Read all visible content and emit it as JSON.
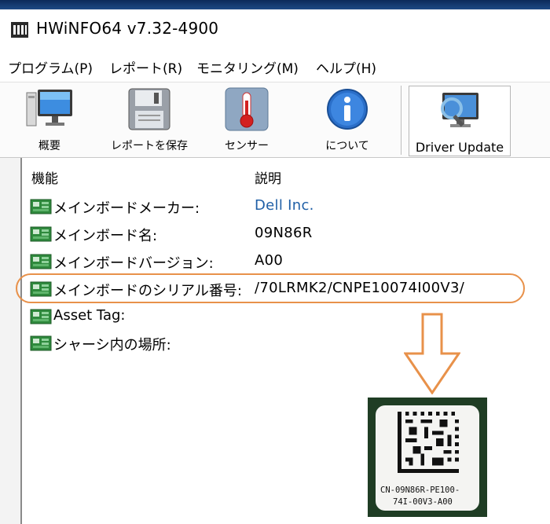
{
  "window": {
    "title": "HWiNFO64 v7.32-4900"
  },
  "menu": [
    "プログラム(P)",
    "レポート(R)",
    "モニタリング(M)",
    "ヘルプ(H)"
  ],
  "toolbar": {
    "summary": "概要",
    "save_report": "レポートを保存",
    "sensors": "センサー",
    "about": "について",
    "driver_update": "Driver Update"
  },
  "table": {
    "headers": {
      "feature": "機能",
      "description": "説明"
    },
    "rows": [
      {
        "feature": "メインボードメーカー:",
        "value": "Dell Inc."
      },
      {
        "feature": "メインボード名:",
        "value": "09N86R"
      },
      {
        "feature": "メインボードバージョン:",
        "value": "A00"
      },
      {
        "feature": "メインボードのシリアル番号:",
        "value": "/70LRMK2/CNPE10074I00V3/"
      },
      {
        "feature": "Asset Tag:",
        "value": ""
      },
      {
        "feature": "シャーシ内の場所:",
        "value": ""
      }
    ]
  },
  "annotation": {
    "highlighted_row": "メインボードのシリアル番号:",
    "color": "#e8914a"
  },
  "label_photo": {
    "line1": "CN-09N86R-PE100-",
    "line2": "74I-00V3-A00"
  },
  "colors": {
    "link": "#1f5fa6",
    "accent": "#e8914a"
  }
}
